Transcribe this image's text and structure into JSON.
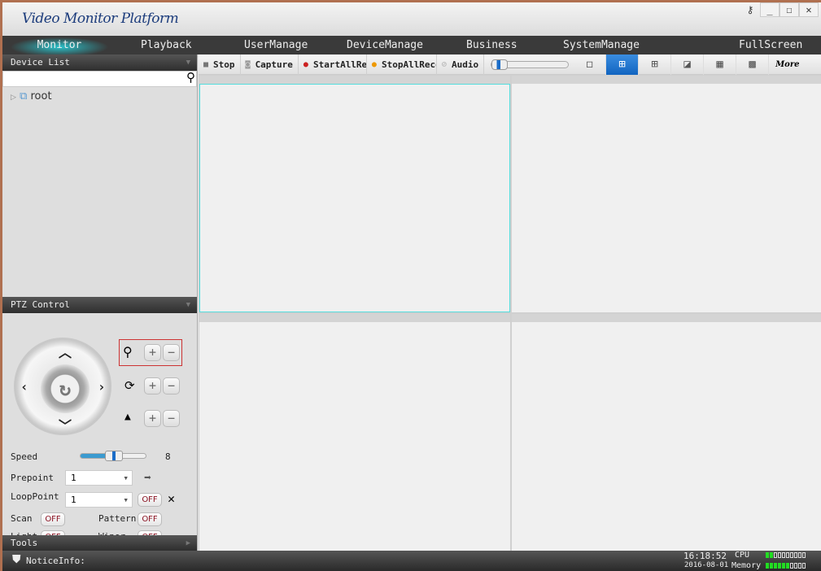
{
  "app": {
    "title": "Video Monitor Platform"
  },
  "window_controls": [
    "key-icon",
    "minimize",
    "maximize",
    "close"
  ],
  "nav": {
    "items": [
      {
        "label": "Monitor",
        "active": true
      },
      {
        "label": "Playback"
      },
      {
        "label": "UserManage"
      },
      {
        "label": "DeviceManage"
      },
      {
        "label": "Business"
      },
      {
        "label": "SystemManage"
      },
      {
        "label": "FullScreen"
      }
    ]
  },
  "device_list": {
    "title": "Device List",
    "search_placeholder": "",
    "tree": [
      {
        "label": "root"
      }
    ]
  },
  "ptz": {
    "title": "PTZ Control",
    "speed_label": "Speed",
    "speed_value": "8",
    "speed_max": 10,
    "prepoint_label": "Prepoint",
    "prepoint_value": "1",
    "loop_label": "LoopPoint",
    "loop_value": "1",
    "loop_state": "OFF",
    "scan_label": "Scan",
    "scan_state": "OFF",
    "pattern_label": "Pattern",
    "pattern_state": "OFF",
    "light_label": "Light",
    "light_state": "OFF",
    "wiper_label": "Wiper",
    "wiper_state": "OFF"
  },
  "tools": {
    "title": "Tools"
  },
  "toolbar": {
    "stop": "Stop",
    "capture": "Capture",
    "start_all": "StartAllRecord",
    "stop_all": "StopAllRecord",
    "audio": "Audio",
    "more": "More",
    "volume": 0.05,
    "layouts": [
      "1",
      "4",
      "6",
      "8",
      "9",
      "16"
    ],
    "active_layout": "4"
  },
  "status": {
    "notice": "NoticeInfo:",
    "time": "16:18:52",
    "date": "2016-08-01",
    "cpu_label": "CPU",
    "memory_label": "Memory",
    "cpu_level": 2,
    "memory_level": 6,
    "meter_total": 10
  },
  "colors": {
    "accent": "#1164c0",
    "selected_cell": "#55dddd",
    "off_text": "#8a1020"
  }
}
